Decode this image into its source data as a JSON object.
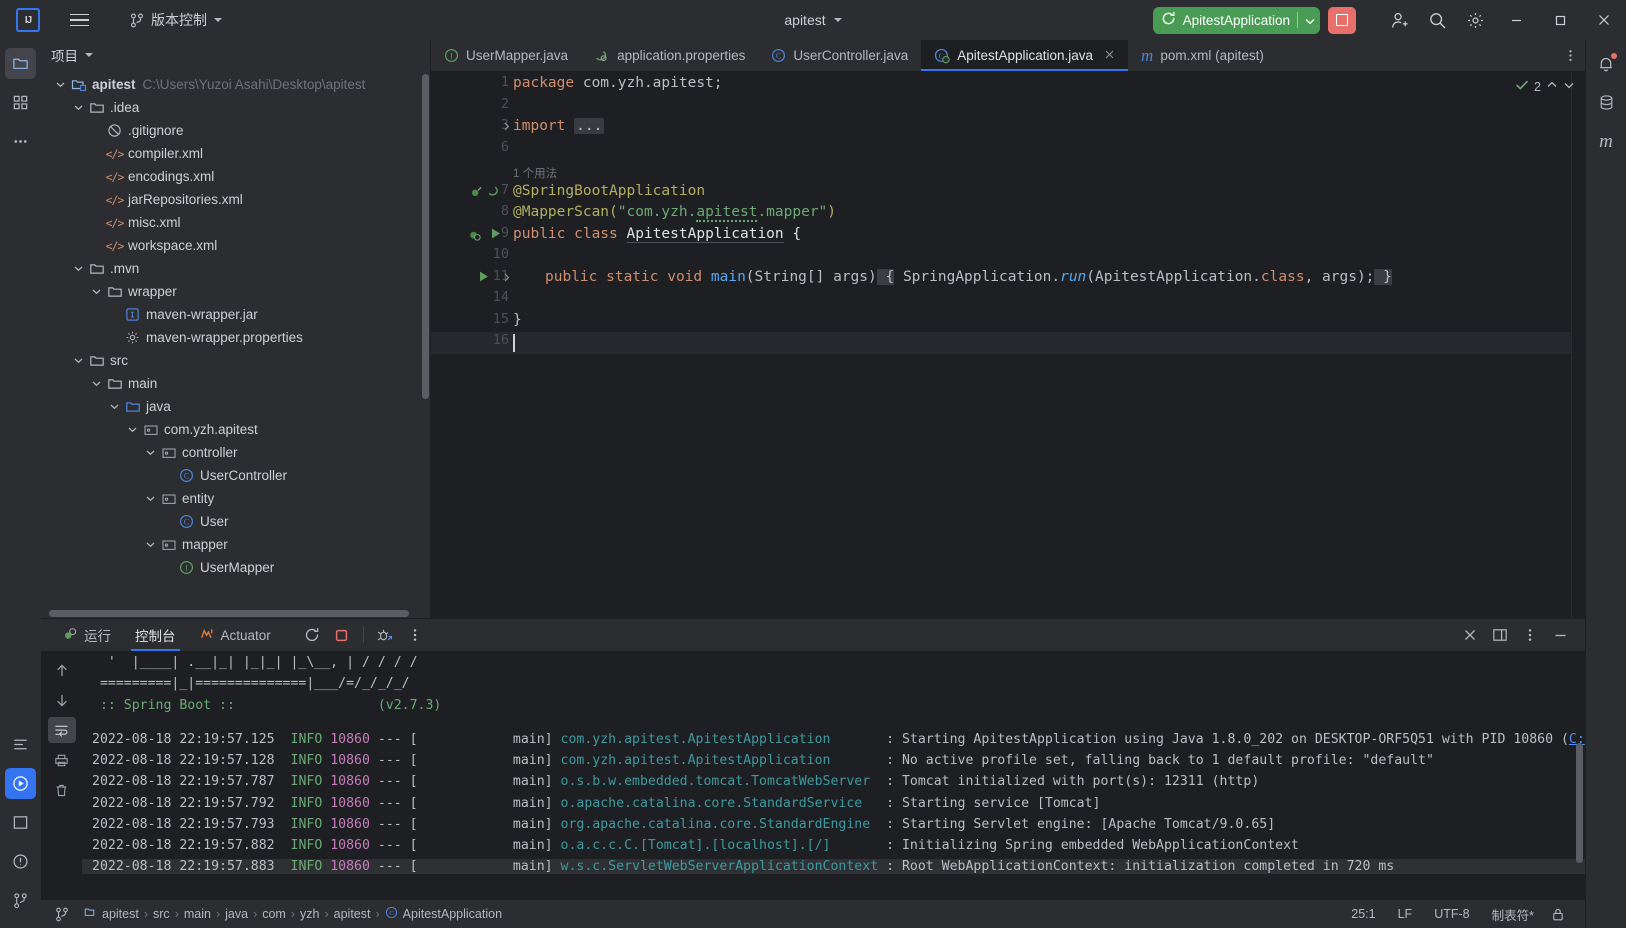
{
  "titlebar": {
    "logo_text": "IJ",
    "menu_icon": "hamburger-icon",
    "vcs_label": "版本控制",
    "project_name": "apitest",
    "run_config_label": "ApitestApplication",
    "rerun_icon": "rerun-icon",
    "stop_icon": "stop-icon",
    "account_icon": "account-add-icon",
    "search_icon": "search-icon",
    "settings_icon": "gear-icon",
    "minimize": "−",
    "maximize": "□",
    "close": "✕"
  },
  "left_stripe": [
    {
      "name": "project",
      "icon": "folder-icon",
      "active": true
    },
    {
      "name": "structure",
      "icon": "structure-icon",
      "active": false
    },
    {
      "name": "more",
      "icon": "more-dots-icon",
      "active": false
    }
  ],
  "left_stripe_bottom": [
    {
      "name": "terminal",
      "icon": "terminal-icon"
    },
    {
      "name": "run",
      "icon": "run-icon",
      "active": true
    },
    {
      "name": "services",
      "icon": "services-icon"
    },
    {
      "name": "problems",
      "icon": "problems-icon"
    },
    {
      "name": "git",
      "icon": "git-branch-icon"
    }
  ],
  "right_stripe": [
    {
      "name": "notifications",
      "icon": "bell-icon",
      "badge": true
    },
    {
      "name": "database",
      "icon": "database-icon"
    },
    {
      "name": "maven",
      "icon": "maven-m-icon"
    }
  ],
  "project_panel": {
    "title": "项目",
    "tree": [
      {
        "depth": 0,
        "label": "apitest",
        "icon": "project-folder-icon",
        "bold": true,
        "expanded": true,
        "path": "C:\\Users\\Yuzoi Asahi\\Desktop\\apitest"
      },
      {
        "depth": 1,
        "label": ".idea",
        "icon": "folder-icon",
        "expanded": true
      },
      {
        "depth": 2,
        "label": ".gitignore",
        "icon": "gitignore-icon"
      },
      {
        "depth": 2,
        "label": "compiler.xml",
        "icon": "xml-icon"
      },
      {
        "depth": 2,
        "label": "encodings.xml",
        "icon": "xml-icon"
      },
      {
        "depth": 2,
        "label": "jarRepositories.xml",
        "icon": "xml-icon"
      },
      {
        "depth": 2,
        "label": "misc.xml",
        "icon": "xml-icon"
      },
      {
        "depth": 2,
        "label": "workspace.xml",
        "icon": "xml-icon"
      },
      {
        "depth": 1,
        "label": ".mvn",
        "icon": "folder-icon",
        "expanded": true
      },
      {
        "depth": 2,
        "label": "wrapper",
        "icon": "folder-icon",
        "expanded": true
      },
      {
        "depth": 3,
        "label": "maven-wrapper.jar",
        "icon": "jar-icon"
      },
      {
        "depth": 3,
        "label": "maven-wrapper.properties",
        "icon": "properties-icon"
      },
      {
        "depth": 1,
        "label": "src",
        "icon": "folder-icon",
        "expanded": true
      },
      {
        "depth": 2,
        "label": "main",
        "icon": "folder-icon",
        "expanded": true
      },
      {
        "depth": 3,
        "label": "java",
        "icon": "source-folder-icon",
        "expanded": true
      },
      {
        "depth": 4,
        "label": "com.yzh.apitest",
        "icon": "package-icon",
        "expanded": true
      },
      {
        "depth": 5,
        "label": "controller",
        "icon": "package-icon",
        "expanded": true
      },
      {
        "depth": 6,
        "label": "UserController",
        "icon": "class-icon"
      },
      {
        "depth": 5,
        "label": "entity",
        "icon": "package-icon",
        "expanded": true
      },
      {
        "depth": 6,
        "label": "User",
        "icon": "class-icon"
      },
      {
        "depth": 5,
        "label": "mapper",
        "icon": "package-icon",
        "expanded": true
      },
      {
        "depth": 6,
        "label": "UserMapper",
        "icon": "interface-icon"
      }
    ]
  },
  "editor_tabs": [
    {
      "label": "UserMapper.java",
      "icon": "interface-icon",
      "active": false,
      "closable": false
    },
    {
      "label": "application.properties",
      "icon": "spring-properties-icon",
      "active": false,
      "closable": false
    },
    {
      "label": "UserController.java",
      "icon": "class-icon",
      "active": false,
      "closable": false
    },
    {
      "label": "ApitestApplication.java",
      "icon": "spring-class-icon",
      "active": true,
      "closable": true
    },
    {
      "label": "pom.xml (apitest)",
      "icon": "maven-m-icon",
      "active": false,
      "closable": false
    }
  ],
  "editor": {
    "inspection_count": "2",
    "usage_hint": "1 个用法",
    "line_numbers": [
      "1",
      "2",
      "3",
      "6",
      "7",
      "8",
      "9",
      "10",
      "11",
      "14",
      "15",
      "16"
    ],
    "code": {
      "l1_kw": "package",
      "l1_rest": " com.yzh.apitest;",
      "l3_kw": "import",
      "l3_fold": "...",
      "l7": "@SpringBootApplication",
      "l8_anno": "@MapperScan(",
      "l8_str": "\"com.yzh.apitest.mapper\"",
      "l8_end": ")",
      "l9_kw": "public class",
      "l9_name": " ApitestApplication {",
      "l11_a": "public static void ",
      "l11_main": "main",
      "l11_b": "(String[] args) ",
      "l11_brace": "{",
      "l11_c": " SpringApplication.",
      "l11_run": "run",
      "l11_d": "(ApitestApplication.",
      "l11_class": "class",
      "l11_e": ", args); ",
      "l11_f": "}",
      "l15": "}"
    }
  },
  "run_window": {
    "tabs": [
      {
        "label": "运行",
        "icon": "run-config-icon",
        "active": false
      },
      {
        "label": "控制台",
        "icon": "none",
        "active": true
      },
      {
        "label": "Actuator",
        "icon": "actuator-icon",
        "active": false
      }
    ],
    "buttons": [
      {
        "name": "rerun",
        "icon": "rerun-icon"
      },
      {
        "name": "stop",
        "icon": "stop-square-icon"
      },
      {
        "name": "debug-attach",
        "icon": "bug-attach-icon"
      },
      {
        "name": "more-options",
        "icon": "more-vertical-icon"
      }
    ],
    "right_buttons": [
      {
        "name": "close",
        "icon": "close-icon"
      },
      {
        "name": "split",
        "icon": "split-layout-icon"
      },
      {
        "name": "options",
        "icon": "more-vertical-icon"
      },
      {
        "name": "minimize",
        "icon": "minimize-icon"
      }
    ],
    "sidebar": [
      {
        "name": "scroll-up",
        "icon": "arrow-up-icon"
      },
      {
        "name": "scroll-down",
        "icon": "arrow-down-icon"
      },
      {
        "name": "soft-wrap",
        "icon": "wrap-icon",
        "active": true
      },
      {
        "name": "print",
        "icon": "print-icon"
      },
      {
        "name": "clear-all",
        "icon": "trash-icon"
      }
    ],
    "banner": [
      "  '  |____| .__|_| |_|_| |_\\__, | / / / /",
      " =========|_|==============|___/=/_/_/_/",
      " :: Spring Boot ::                (v2.7.3)"
    ],
    "banner_version": "(v2.7.3)",
    "log_lines": [
      {
        "date": "2022-08-18 22:19:57.125",
        "level": "INFO",
        "pid": "10860",
        "thread": "main",
        "logger": "com.yzh.apitest.ApitestApplication",
        "msg": ": Starting ApitestApplication using Java 1.8.0_202 on DESKTOP-ORF5Q51 with PID 10860 (",
        "link": "C:"
      },
      {
        "date": "2022-08-18 22:19:57.128",
        "level": "INFO",
        "pid": "10860",
        "thread": "main",
        "logger": "com.yzh.apitest.ApitestApplication",
        "msg": ": No active profile set, falling back to 1 default profile: \"default\""
      },
      {
        "date": "2022-08-18 22:19:57.787",
        "level": "INFO",
        "pid": "10860",
        "thread": "main",
        "logger": "o.s.b.w.embedded.tomcat.TomcatWebServer",
        "msg": ": Tomcat initialized with port(s): 12311 (http)"
      },
      {
        "date": "2022-08-18 22:19:57.792",
        "level": "INFO",
        "pid": "10860",
        "thread": "main",
        "logger": "o.apache.catalina.core.StandardService",
        "msg": ": Starting service [Tomcat]"
      },
      {
        "date": "2022-08-18 22:19:57.793",
        "level": "INFO",
        "pid": "10860",
        "thread": "main",
        "logger": "org.apache.catalina.core.StandardEngine",
        "msg": ": Starting Servlet engine: [Apache Tomcat/9.0.65]"
      },
      {
        "date": "2022-08-18 22:19:57.882",
        "level": "INFO",
        "pid": "10860",
        "thread": "main",
        "logger": "o.a.c.c.C.[Tomcat].[localhost].[/]",
        "msg": ": Initializing Spring embedded WebApplicationContext"
      },
      {
        "date": "2022-08-18 22:19:57.883",
        "level": "INFO",
        "pid": "10860",
        "thread": "main",
        "logger": "w.s.c.ServletWebServerApplicationContext",
        "msg": ": Root WebApplicationContext: initialization completed in 720 ms"
      }
    ]
  },
  "statusbar": {
    "crumbs": [
      "apitest",
      "src",
      "main",
      "java",
      "com",
      "yzh",
      "apitest",
      "ApitestApplication"
    ],
    "caret_position": "25:1",
    "line_separator": "LF",
    "encoding": "UTF-8",
    "indent": "制表符*",
    "lock_icon": "lock-icon",
    "git_icon": "git-branch-icon"
  }
}
